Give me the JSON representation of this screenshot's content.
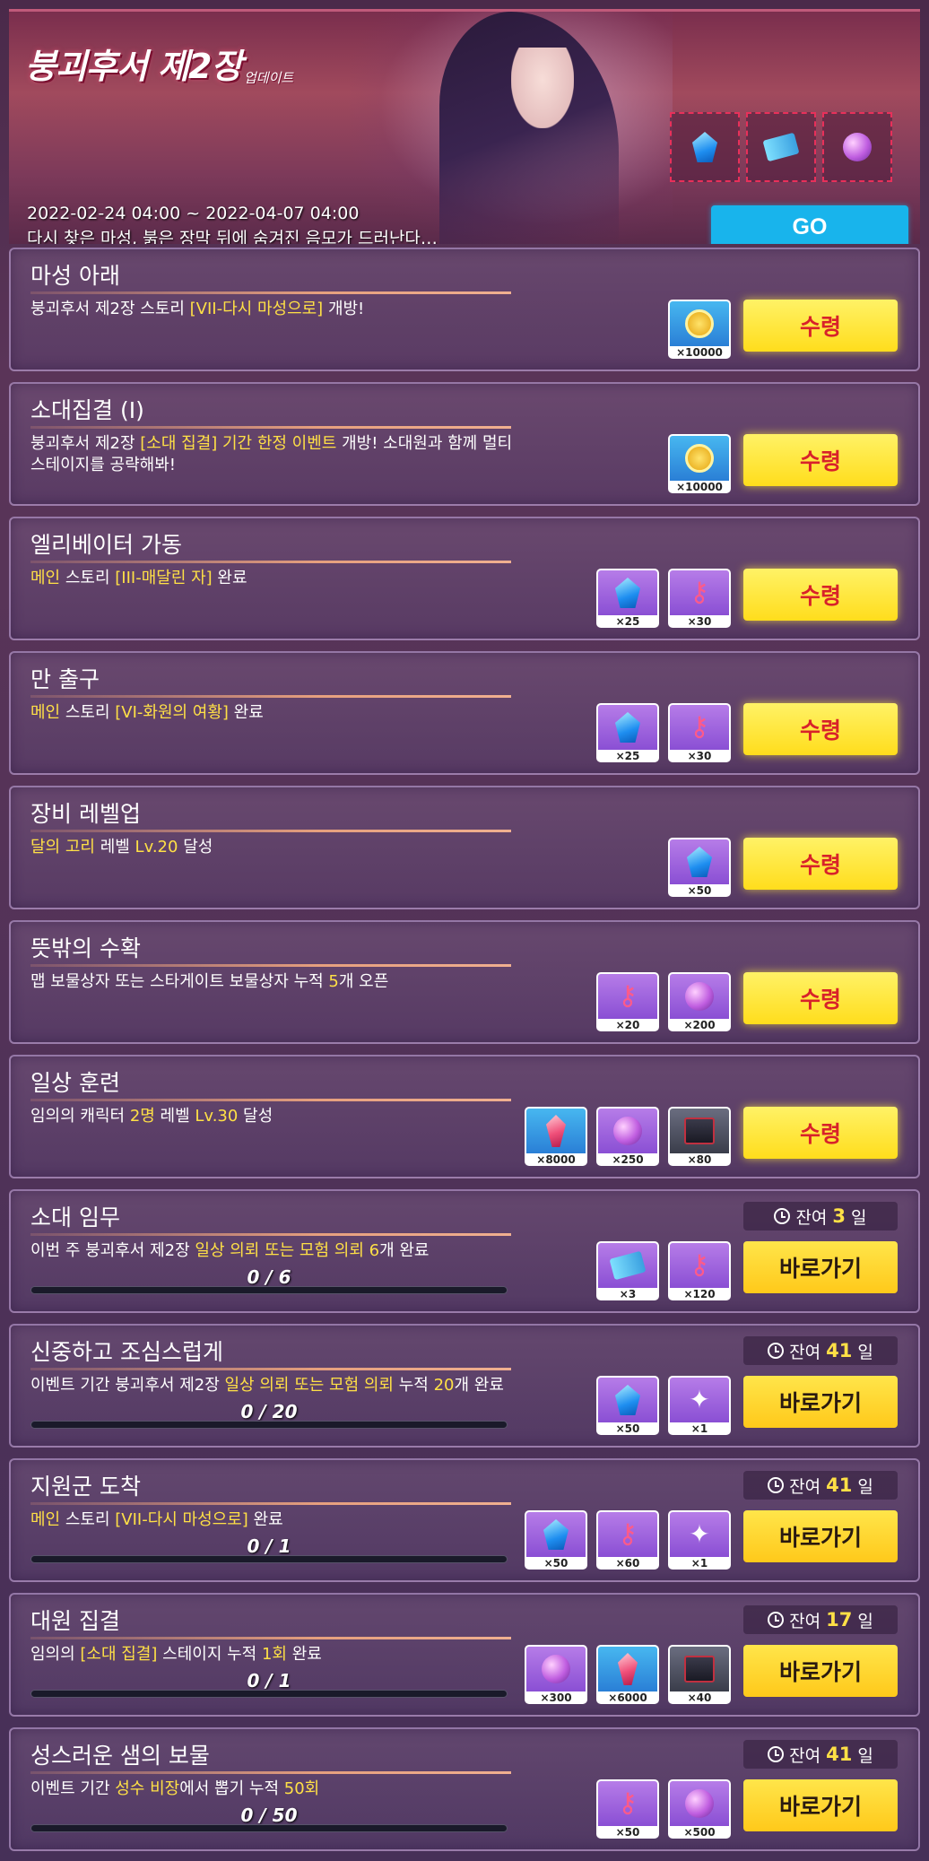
{
  "header": {
    "logo_main": "붕괴후서 제2장",
    "logo_sub": "업데이트",
    "date_range": "2022-02-24 04:00 ~ 2022-04-07 04:00",
    "description": "다시 찾은 마성, 붉은 장막 뒤에 숨겨진 음모가 드러난다…",
    "go_label": "GO"
  },
  "labels": {
    "claim": "수령",
    "goto": "바로가기",
    "remaining": "잔여",
    "day": "일"
  },
  "missions": [
    {
      "title": "마성 아래",
      "desc_parts": [
        {
          "t": "붕괴후서 제2장 스토리 "
        },
        {
          "t": "[VII-다시 마성으로]",
          "hl": true
        },
        {
          "t": " 개방!"
        }
      ],
      "rewards": [
        {
          "icon": "gold-coin",
          "qty": "×10000"
        }
      ],
      "status": "claim"
    },
    {
      "title": "소대집결 (I)",
      "desc_parts": [
        {
          "t": "붕괴후서 제2장 "
        },
        {
          "t": "[소대 집결] 기간 한정 이벤트",
          "hl": true
        },
        {
          "t": " 개방! 소대원과 함께 멀티 스테이지를 공략해봐!"
        }
      ],
      "rewards": [
        {
          "icon": "gold-coin",
          "qty": "×10000"
        }
      ],
      "status": "claim"
    },
    {
      "title": "엘리베이터 가동",
      "desc_parts": [
        {
          "t": "메인",
          "hl": true
        },
        {
          "t": " 스토리 "
        },
        {
          "t": "[III-매달린 자]",
          "hl": true
        },
        {
          "t": " 완료"
        }
      ],
      "rewards": [
        {
          "icon": "blue-crystal",
          "qty": "×25"
        },
        {
          "icon": "key",
          "qty": "×30"
        }
      ],
      "status": "claim"
    },
    {
      "title": "만 출구",
      "desc_parts": [
        {
          "t": "메인",
          "hl": true
        },
        {
          "t": " 스토리 "
        },
        {
          "t": "[VI-화원의 여황]",
          "hl": true
        },
        {
          "t": " 완료"
        }
      ],
      "rewards": [
        {
          "icon": "blue-crystal",
          "qty": "×25"
        },
        {
          "icon": "key",
          "qty": "×30"
        }
      ],
      "status": "claim"
    },
    {
      "title": "장비 레벨업",
      "desc_parts": [
        {
          "t": "달의 고리",
          "hl": true
        },
        {
          "t": " 레벨 "
        },
        {
          "t": "Lv.20",
          "hl": true
        },
        {
          "t": " 달성"
        }
      ],
      "rewards": [
        {
          "icon": "blue-crystal",
          "qty": "×50"
        }
      ],
      "status": "claim"
    },
    {
      "title": "뜻밖의 수확",
      "desc_parts": [
        {
          "t": "맵 보물상자 또는 스타게이트 보물상자 누적 "
        },
        {
          "t": "5",
          "hl": true
        },
        {
          "t": "개 오픈"
        }
      ],
      "rewards": [
        {
          "icon": "key",
          "qty": "×20"
        },
        {
          "icon": "purple-orb",
          "qty": "×200"
        }
      ],
      "status": "claim"
    },
    {
      "title": "일상 훈련",
      "desc_parts": [
        {
          "t": "임의의 캐릭터 "
        },
        {
          "t": "2명",
          "hl": true
        },
        {
          "t": " 레벨 "
        },
        {
          "t": "Lv.30",
          "hl": true
        },
        {
          "t": " 달성"
        }
      ],
      "rewards": [
        {
          "icon": "red-crystal",
          "qty": "×8000"
        },
        {
          "icon": "purple-orb",
          "qty": "×250"
        },
        {
          "icon": "dark-box",
          "qty": "×80"
        }
      ],
      "status": "claim"
    },
    {
      "title": "소대 임무",
      "desc_parts": [
        {
          "t": "이번 주 붕괴후서 제2장 "
        },
        {
          "t": "일상 의뢰 또는 모험 의뢰 6",
          "hl": true
        },
        {
          "t": "개 완료"
        }
      ],
      "rewards": [
        {
          "icon": "ticket",
          "qty": "×3"
        },
        {
          "icon": "key",
          "qty": "×120"
        }
      ],
      "status": "goto",
      "days": "3",
      "progress": "0 / 6"
    },
    {
      "title": "신중하고 조심스럽게",
      "desc_parts": [
        {
          "t": "이벤트 기간 붕괴후서 제2장 "
        },
        {
          "t": "일상 의뢰 또는 모험 의뢰",
          "hl": true
        },
        {
          "t": " 누적 "
        },
        {
          "t": "20",
          "hl": true
        },
        {
          "t": "개 완료"
        }
      ],
      "rewards": [
        {
          "icon": "blue-crystal",
          "qty": "×50"
        },
        {
          "icon": "wand",
          "qty": "×1"
        }
      ],
      "status": "goto",
      "days": "41",
      "progress": "0 / 20"
    },
    {
      "title": "지원군 도착",
      "desc_parts": [
        {
          "t": "메인",
          "hl": true
        },
        {
          "t": " 스토리 "
        },
        {
          "t": "[VII-다시 마성으로]",
          "hl": true
        },
        {
          "t": " 완료"
        }
      ],
      "rewards": [
        {
          "icon": "blue-crystal",
          "qty": "×50"
        },
        {
          "icon": "key",
          "qty": "×60"
        },
        {
          "icon": "wand",
          "qty": "×1"
        }
      ],
      "status": "goto",
      "days": "41",
      "progress": "0 / 1"
    },
    {
      "title": "대원 집결",
      "desc_parts": [
        {
          "t": "임의의 "
        },
        {
          "t": "[소대 집결]",
          "hl": true
        },
        {
          "t": " 스테이지 누적 "
        },
        {
          "t": "1회",
          "hl": true
        },
        {
          "t": " 완료"
        }
      ],
      "rewards": [
        {
          "icon": "purple-orb",
          "qty": "×300"
        },
        {
          "icon": "red-crystal",
          "qty": "×6000"
        },
        {
          "icon": "dark-box",
          "qty": "×40"
        }
      ],
      "status": "goto",
      "days": "17",
      "progress": "0 / 1"
    },
    {
      "title": "성스러운 샘의 보물",
      "desc_parts": [
        {
          "t": "이벤트 기간 "
        },
        {
          "t": "성수 비장",
          "hl": true
        },
        {
          "t": "에서 뽑기 누적 "
        },
        {
          "t": "50회",
          "hl": true
        }
      ],
      "rewards": [
        {
          "icon": "key",
          "qty": "×50"
        },
        {
          "icon": "purple-orb",
          "qty": "×500"
        }
      ],
      "status": "goto",
      "days": "41",
      "progress": "0 / 50"
    }
  ]
}
